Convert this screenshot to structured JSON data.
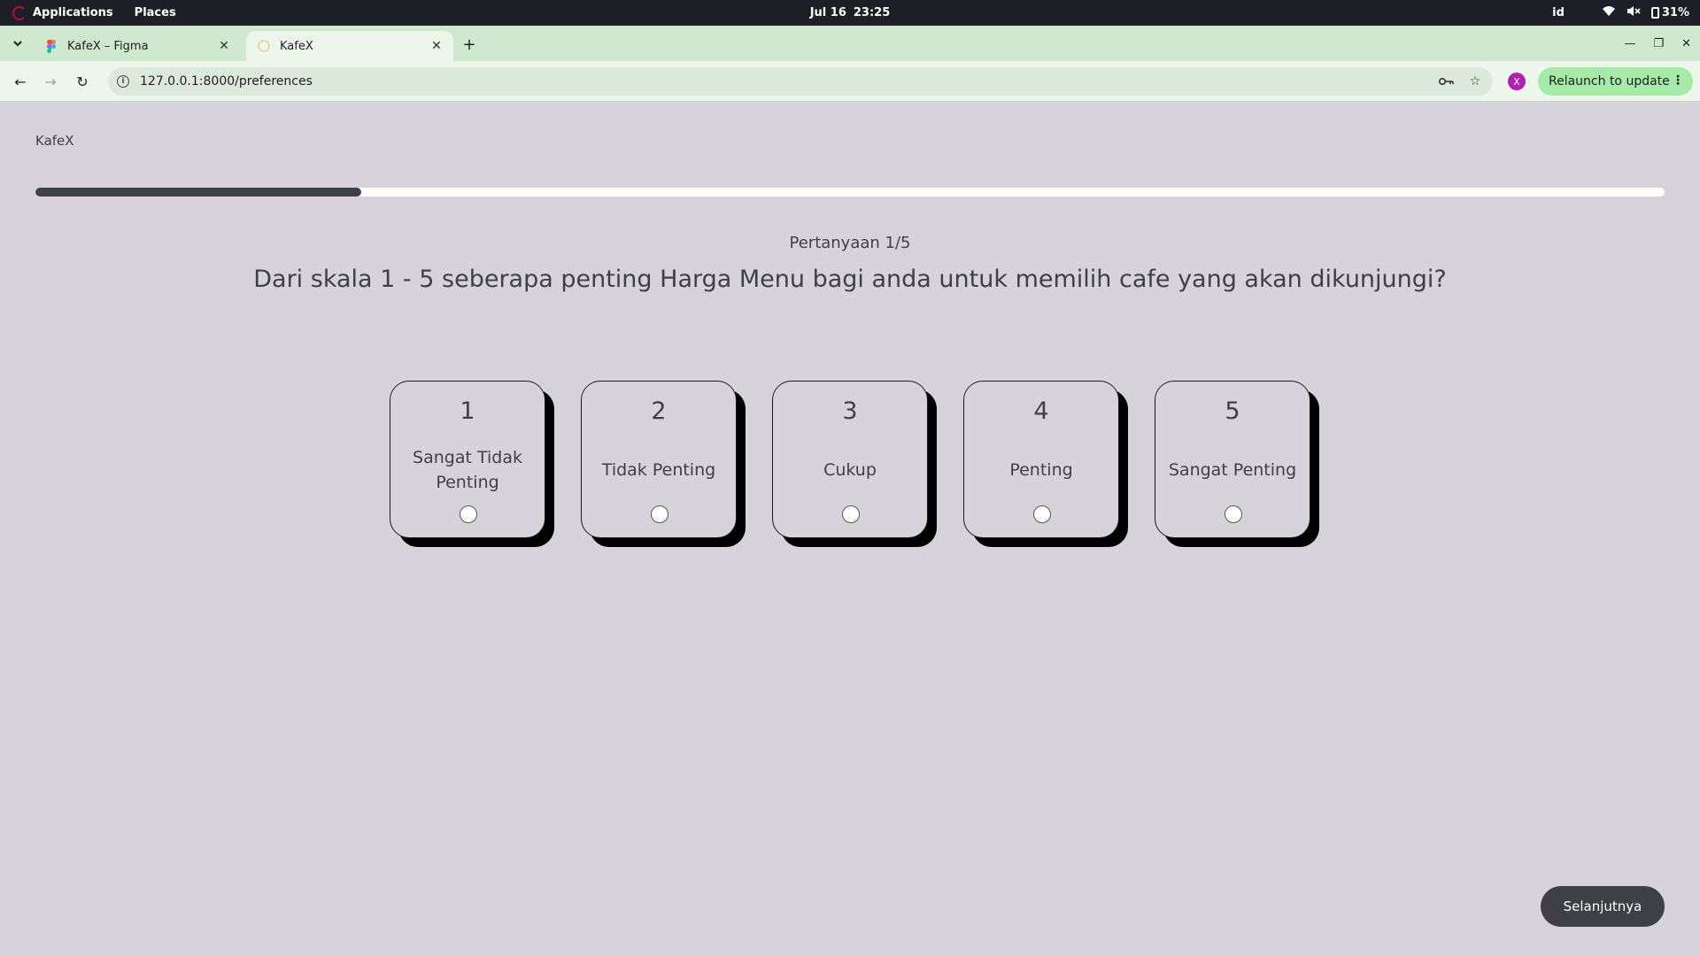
{
  "system_bar": {
    "applications": "Applications",
    "places": "Places",
    "date": "Jul 16",
    "time": "23:25",
    "language": "id",
    "battery": "31%"
  },
  "browser": {
    "tabs": [
      {
        "title": "KafeX – Figma",
        "active": false
      },
      {
        "title": "KafeX",
        "active": true
      }
    ],
    "url": "127.0.0.1:8000/preferences",
    "profile_initial": "X",
    "relaunch_label": "Relaunch to update"
  },
  "page": {
    "brand": "KafeX",
    "progress_fraction": 0.2,
    "question_counter": "Pertanyaan 1/5",
    "question": "Dari skala 1 - 5 seberapa penting Harga Menu bagi anda untuk memilih cafe yang akan dikunjungi?",
    "options": [
      {
        "value": "1",
        "label": "Sangat Tidak Penting"
      },
      {
        "value": "2",
        "label": "Tidak Penting"
      },
      {
        "value": "3",
        "label": "Cukup"
      },
      {
        "value": "4",
        "label": "Penting"
      },
      {
        "value": "5",
        "label": "Sangat Penting"
      }
    ],
    "next_button": "Selanjutnya"
  },
  "colors": {
    "page_background": "#d6d3db",
    "primary_dark": "#3f3f46",
    "tabstrip": "#cfe8cf",
    "relaunch": "#a6eaa7",
    "profile": "#b21fb3"
  }
}
